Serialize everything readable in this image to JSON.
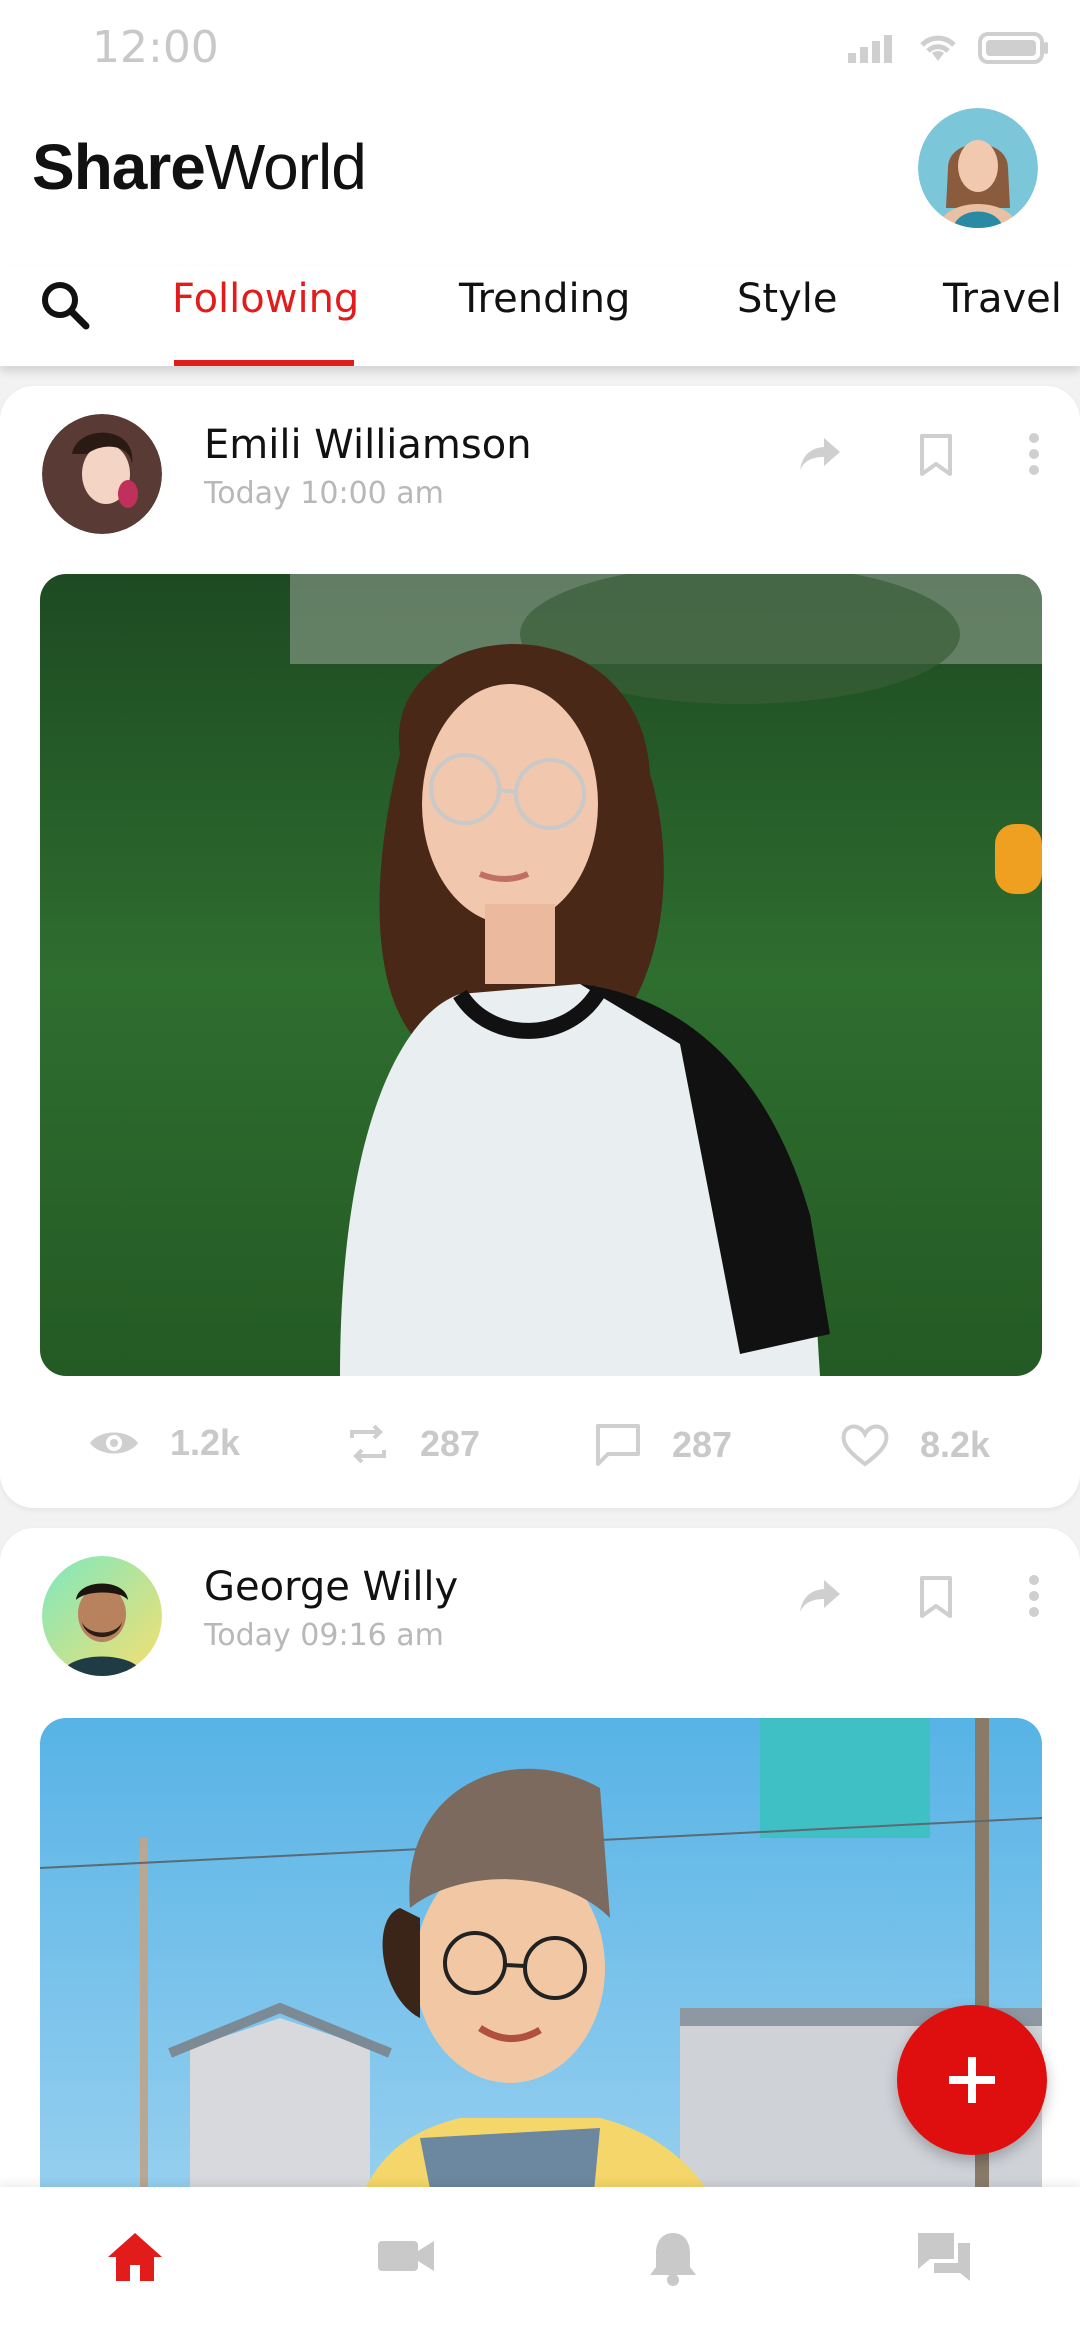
{
  "status": {
    "time": "12:00"
  },
  "header": {
    "brand_bold": "Share",
    "brand_regular": "World"
  },
  "tabs": [
    {
      "label": "Following",
      "active": true
    },
    {
      "label": "Trending"
    },
    {
      "label": "Style"
    },
    {
      "label": "Travel"
    }
  ],
  "posts": [
    {
      "author": "Emili Williamson",
      "time": "Today 10:00 am",
      "stats": {
        "views": "1.2k",
        "reposts": "287",
        "comments": "287",
        "likes": "8.2k"
      }
    },
    {
      "author": "George Willy",
      "time": "Today 09:16 am"
    }
  ],
  "icons": {
    "search": "search-icon",
    "share": "share-icon",
    "bookmark": "bookmark-icon",
    "more": "more-vertical-icon",
    "views": "eye-icon",
    "reposts": "repost-icon",
    "comments": "comment-icon",
    "likes": "heart-icon",
    "home": "home-icon",
    "video": "video-icon",
    "bell": "bell-icon",
    "chat": "chat-icon",
    "fab": "plus-icon"
  },
  "colors": {
    "accent": "#e21b1b",
    "muted": "#c9c9c9"
  }
}
